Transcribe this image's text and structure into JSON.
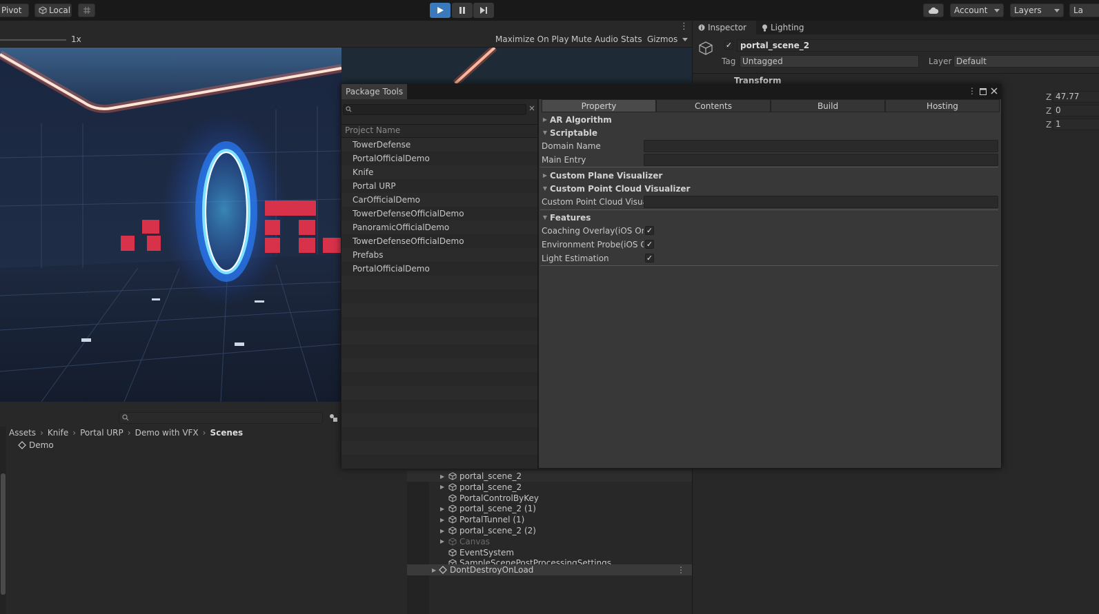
{
  "toolbar": {
    "pivot": "Pivot",
    "local": "Local",
    "account": "Account",
    "layers": "Layers"
  },
  "game": {
    "scale": "1x",
    "maximize": "Maximize On Play",
    "mute": "Mute Audio",
    "stats": "Stats",
    "gizmos": "Gizmos"
  },
  "inspector": {
    "tab_inspector": "Inspector",
    "tab_lighting": "Lighting",
    "object_name": "portal_scene_2",
    "tag_label": "Tag",
    "tag_value": "Untagged",
    "layer_label": "Layer",
    "layer_value": "Default",
    "transform_label": "Transform",
    "z_label": "Z",
    "z_values": [
      "47.77",
      "0",
      "1"
    ]
  },
  "project": {
    "breadcrumb": [
      "Assets",
      "Knife",
      "Portal URP",
      "Demo with VFX",
      "Scenes"
    ],
    "items": [
      "Demo"
    ]
  },
  "hierarchy": {
    "items": [
      {
        "name": "portal_scene_2",
        "arrow": true,
        "dim": false
      },
      {
        "name": "portal_scene_2",
        "arrow": true,
        "dim": false
      },
      {
        "name": "PortalControlByKey",
        "arrow": false,
        "dim": false
      },
      {
        "name": "portal_scene_2 (1)",
        "arrow": true,
        "dim": false
      },
      {
        "name": "PortalTunnel (1)",
        "arrow": true,
        "dim": false
      },
      {
        "name": "portal_scene_2 (2)",
        "arrow": true,
        "dim": false
      },
      {
        "name": "Canvas",
        "arrow": true,
        "dim": true
      },
      {
        "name": "EventSystem",
        "arrow": false,
        "dim": false
      },
      {
        "name": "SampleScenePostProcessingSettings",
        "arrow": false,
        "dim": false
      }
    ],
    "dontdestroy": "DontDestroyOnLoad"
  },
  "package_tools": {
    "title": "Package Tools",
    "search_placeholder": "",
    "list_header": "Project Name",
    "projects": [
      "TowerDefense",
      "PortalOfficialDemo",
      "Knife",
      "Portal URP",
      "CarOfficialDemo",
      "TowerDefenseOfficialDemo",
      "PanoramicOfficialDemo",
      "TowerDefenseOfficialDemo",
      "Prefabs",
      "PortalOfficialDemo"
    ],
    "tabs": [
      "Property",
      "Contents",
      "Build",
      "Hosting"
    ],
    "active_tab": "Property",
    "sections": {
      "ar_algorithm": "AR Algorithm",
      "scriptable": "Scriptable",
      "domain_name": "Domain Name",
      "main_entry": "Main Entry",
      "custom_plane": "Custom Plane Visualizer",
      "custom_point_cloud": "Custom Point Cloud Visualizer",
      "custom_point_cloud_field": "Custom Point Cloud Visual",
      "features": "Features",
      "coaching": "Coaching Overlay(iOS Only)",
      "environment": "Environment Probe(iOS Only)",
      "light": "Light Estimation"
    },
    "checks": {
      "coaching": true,
      "environment": true,
      "light": true
    }
  },
  "colors": {
    "accent": "#3a79bb",
    "panel": "#282828",
    "window": "#383838"
  }
}
